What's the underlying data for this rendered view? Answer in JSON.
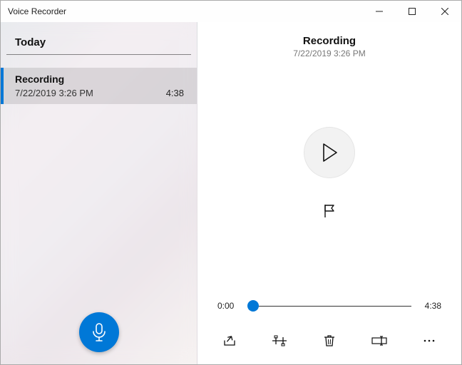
{
  "window": {
    "title": "Voice Recorder"
  },
  "sidebar": {
    "section_label": "Today",
    "recordings": [
      {
        "name": "Recording",
        "datetime": "7/22/2019 3:26 PM",
        "duration": "4:38"
      }
    ]
  },
  "detail": {
    "title": "Recording",
    "datetime": "7/22/2019 3:26 PM",
    "playback": {
      "current": "0:00",
      "total": "4:38",
      "position_pct": 0
    }
  },
  "colors": {
    "accent": "#0078d7"
  }
}
